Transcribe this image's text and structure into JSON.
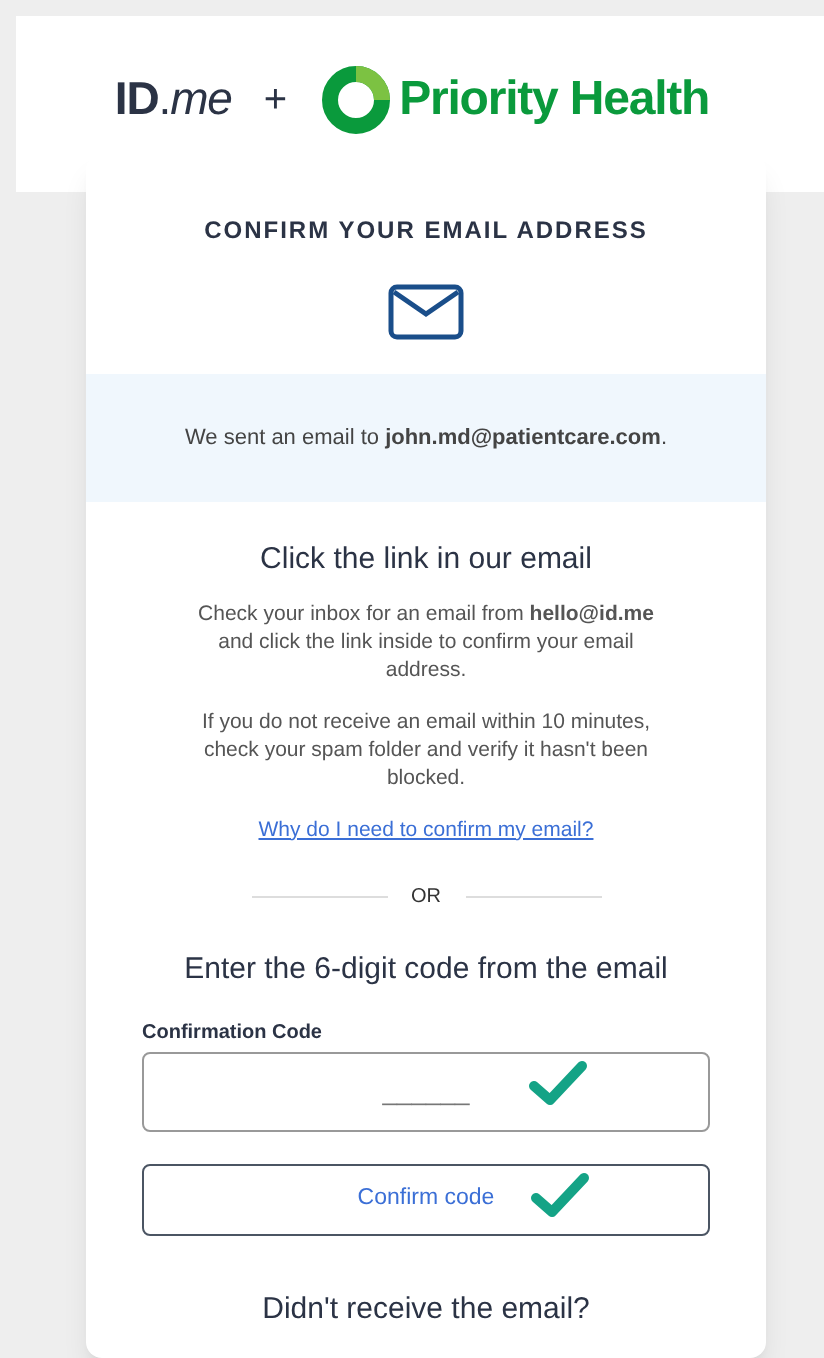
{
  "header": {
    "logo": "**ID**.*me*",
    "plus": "+",
    "partner": "Priority Health"
  },
  "card": {
    "title": "CONFIRM YOUR EMAIL ADDRESS",
    "notice": "We sent an email to **john.md@patientcare.com**.",
    "heading": "Click the link in our email",
    "paragraphs": [
      "Check your inbox for an email from **hello@id.me** and click the link inside to confirm your email address.",
      "If you do not receive an email within 10 minutes, check your spam folder and verify it hasn't been blocked."
    ],
    "link": "Why do I need to confirm my email?",
    "divider": "OR",
    "code_heading": "Enter the 6-digit code from the email",
    "field": {
      "label": "Confirmation Code",
      "placeholder": "______",
      "checked": true
    },
    "button": {
      "label": "Confirm code",
      "checked": true
    },
    "footer_heading": "Didn't receive the email?"
  }
}
